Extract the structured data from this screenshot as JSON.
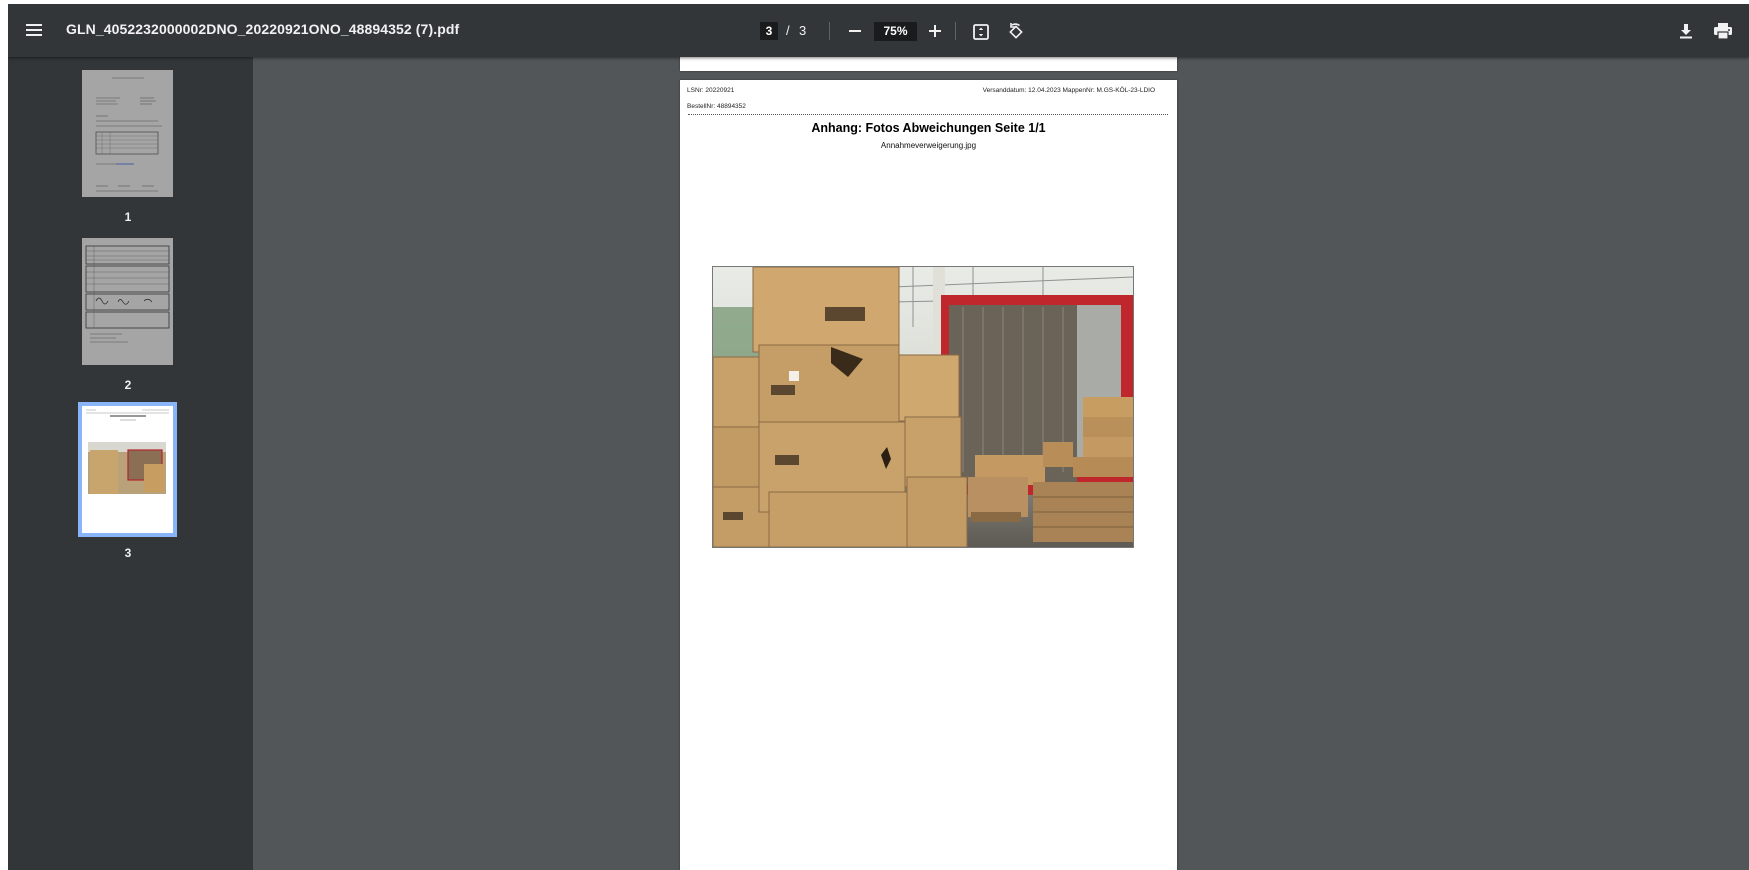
{
  "toolbar": {
    "title": "GLN_4052232000002DNO_20220921ONO_48894352 (7).pdf",
    "current_page": "3",
    "page_separator": "/",
    "total_pages": "3",
    "zoom": "75%"
  },
  "icons": [
    "menu-icon",
    "zoom-out-icon",
    "zoom-in-icon",
    "fit-to-page-icon",
    "rotate-icon",
    "download-icon",
    "print-icon"
  ],
  "sidebar": {
    "thumbnails": [
      {
        "number": "1",
        "selected": false
      },
      {
        "number": "2",
        "selected": false
      },
      {
        "number": "3",
        "selected": true
      }
    ]
  },
  "document": {
    "ls_nr": "LSNr: 20220921",
    "versand": "Versanddatum: 12.04.2023  MappenNr: M.GS-KÖL-23-LDIO",
    "bestell_nr": "BestellNr: 48894352",
    "heading": "Anhang: Fotos Abweichungen Seite  1/1",
    "filename": "Annahmeverweigerung.jpg"
  },
  "colors": {
    "toolbar": "#323639",
    "background": "#525659",
    "selected_thumbnail": "#8ab4f8"
  }
}
